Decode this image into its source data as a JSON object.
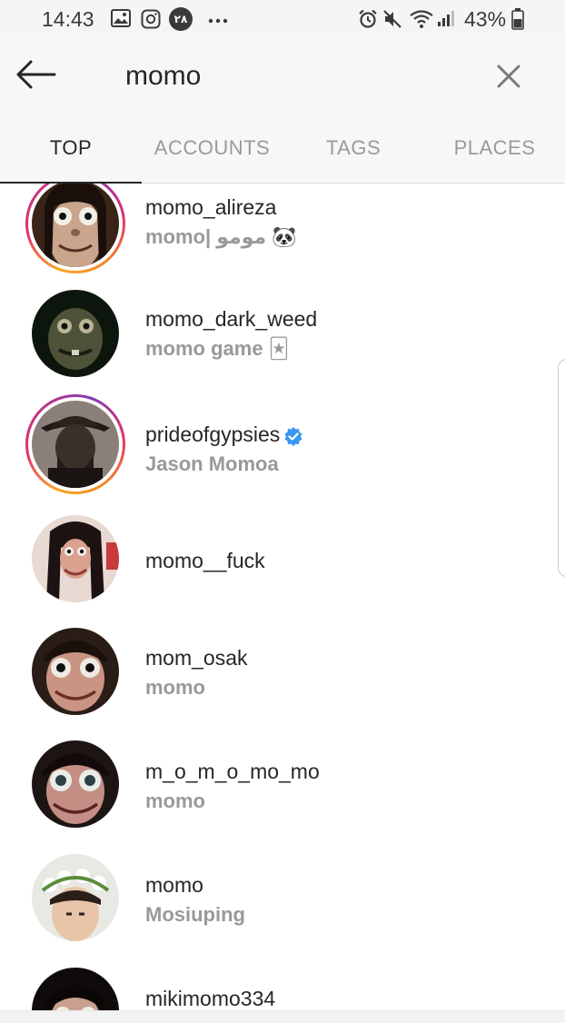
{
  "status_bar": {
    "time": "14:43",
    "left_icons": [
      "gallery-icon",
      "instagram-icon",
      "notification-badge-icon",
      "more-dots-icon"
    ],
    "badge_text": "۲۸",
    "right_icons": [
      "alarm-icon",
      "mute-icon",
      "wifi-icon",
      "signal-icon",
      "battery-icon"
    ],
    "battery": "43%"
  },
  "search": {
    "query": "momo",
    "back_icon": "arrow-left-icon",
    "clear_icon": "close-icon"
  },
  "tabs": [
    {
      "label": "TOP",
      "active": true
    },
    {
      "label": "ACCOUNTS",
      "active": false
    },
    {
      "label": "TAGS",
      "active": false
    },
    {
      "label": "PLACES",
      "active": false
    }
  ],
  "results": [
    {
      "username": "momo_alireza",
      "fullname": "momo| مومو 🐼",
      "story_ring": true,
      "verified": false
    },
    {
      "username": "momo_dark_weed",
      "fullname": "momo game 🃏",
      "story_ring": false,
      "verified": false
    },
    {
      "username": "prideofgypsies",
      "fullname": "Jason Momoa",
      "story_ring": true,
      "verified": true
    },
    {
      "username": "momo__fuck",
      "fullname": "",
      "story_ring": false,
      "verified": false
    },
    {
      "username": "mom_osak",
      "fullname": "momo",
      "story_ring": false,
      "verified": false
    },
    {
      "username": "m_o_m_o_mo_mo",
      "fullname": "momo",
      "story_ring": false,
      "verified": false
    },
    {
      "username": "momo",
      "fullname": "Mosiuping",
      "story_ring": false,
      "verified": false
    },
    {
      "username": "mikimomo334",
      "fullname": "",
      "story_ring": false,
      "verified": false
    }
  ],
  "colors": {
    "verified_blue": "#3897f0",
    "secondary_text": "#999999",
    "primary_text": "#262626"
  }
}
